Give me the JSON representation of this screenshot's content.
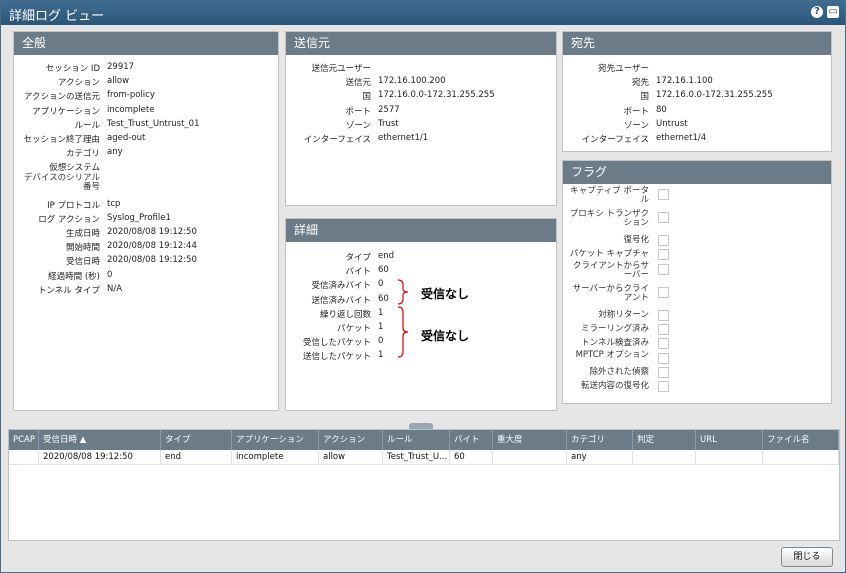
{
  "window": {
    "title": "詳細ログ ビュー",
    "help_glyph": "?",
    "minimize_glyph": "▭"
  },
  "general": {
    "title": "全般",
    "fields": [
      {
        "label": "セッション ID",
        "value": "29917"
      },
      {
        "label": "アクション",
        "value": "allow"
      },
      {
        "label": "アクションの送信元",
        "value": "from-policy"
      },
      {
        "label": "アプリケーション",
        "value": "incomplete"
      },
      {
        "label": "ルール",
        "value": "Test_Trust_Untrust_01"
      },
      {
        "label": "セッション終了理由",
        "value": "aged-out"
      },
      {
        "label": "カテゴリ",
        "value": "any"
      },
      {
        "label": "仮想システム",
        "value": ""
      },
      {
        "label": "デバイスのシリアル番号",
        "value": ""
      },
      {
        "label": "IP プロトコル",
        "value": "tcp"
      },
      {
        "label": "ログ アクション",
        "value": "Syslog_Profile1"
      },
      {
        "label": "生成日時",
        "value": "2020/08/08 19:12:50"
      },
      {
        "label": "開始時間",
        "value": "2020/08/08 19:12:44"
      },
      {
        "label": "受信日時",
        "value": "2020/08/08 19:12:50"
      },
      {
        "label": "経過時間 (秒)",
        "value": "0"
      },
      {
        "label": "トンネル タイプ",
        "value": "N/A"
      }
    ]
  },
  "source": {
    "title": "送信元",
    "fields": [
      {
        "label": "送信元ユーザー",
        "value": ""
      },
      {
        "label": "送信元",
        "value": "172.16.100.200"
      },
      {
        "label": "国",
        "value": "172.16.0.0-172.31.255.255"
      },
      {
        "label": "ポート",
        "value": "2577"
      },
      {
        "label": "ゾーン",
        "value": "Trust"
      },
      {
        "label": "インターフェイス",
        "value": "ethernet1/1"
      }
    ]
  },
  "destination": {
    "title": "宛先",
    "fields": [
      {
        "label": "宛先ユーザー",
        "value": ""
      },
      {
        "label": "宛先",
        "value": "172.16.1.100"
      },
      {
        "label": "国",
        "value": "172.16.0.0-172.31.255.255"
      },
      {
        "label": "ポート",
        "value": "80"
      },
      {
        "label": "ゾーン",
        "value": "Untrust"
      },
      {
        "label": "インターフェイス",
        "value": "ethernet1/4"
      }
    ]
  },
  "details": {
    "title": "詳細",
    "fields": [
      {
        "label": "タイプ",
        "value": "end"
      },
      {
        "label": "バイト",
        "value": "60"
      },
      {
        "label": "受信済みバイト",
        "value": "0"
      },
      {
        "label": "送信済みバイト",
        "value": "60"
      },
      {
        "label": "繰り返し回数",
        "value": "1"
      },
      {
        "label": "パケット",
        "value": "1"
      },
      {
        "label": "受信したパケット",
        "value": "0"
      },
      {
        "label": "送信したパケット",
        "value": "1"
      }
    ],
    "annotation_1": "受信なし",
    "annotation_2": "受信なし"
  },
  "flags": {
    "title": "フラグ",
    "items": [
      {
        "label": "キャプティブ ポータル",
        "checked": false
      },
      {
        "label": "プロキシ トランザクション",
        "checked": false
      },
      {
        "label": "復号化",
        "checked": false
      },
      {
        "label": "パケット キャプチャ",
        "checked": false
      },
      {
        "label": "クライアントからサーバー",
        "checked": false
      },
      {
        "label": "サーバーからクライアント",
        "checked": false
      },
      {
        "label": "対称リターン",
        "checked": false
      },
      {
        "label": "ミラーリング済み",
        "checked": false
      },
      {
        "label": "トンネル検査済み",
        "checked": false
      },
      {
        "label": "MPTCP オプション",
        "checked": false
      },
      {
        "label": "除外された偵察",
        "checked": false
      },
      {
        "label": "転送内容の復号化",
        "checked": false
      }
    ]
  },
  "table": {
    "columns": [
      "PCAP",
      "受信日時 ▲",
      "タイプ",
      "アプリケーション",
      "アクション",
      "ルール",
      "バイト",
      "重大度",
      "カテゴリ",
      "判定",
      "URL",
      "ファイル名"
    ],
    "rows": [
      [
        "",
        "2020/08/08 19:12:50",
        "end",
        "incomplete",
        "allow",
        "Test_Trust_U...",
        "60",
        "",
        "any",
        "",
        "",
        ""
      ]
    ]
  },
  "footer": {
    "close_label": "閉じる"
  },
  "colors": {
    "titlebar": "#2c5677",
    "panel_header": "#6b7c88",
    "annotation_brace": "#e00000"
  }
}
